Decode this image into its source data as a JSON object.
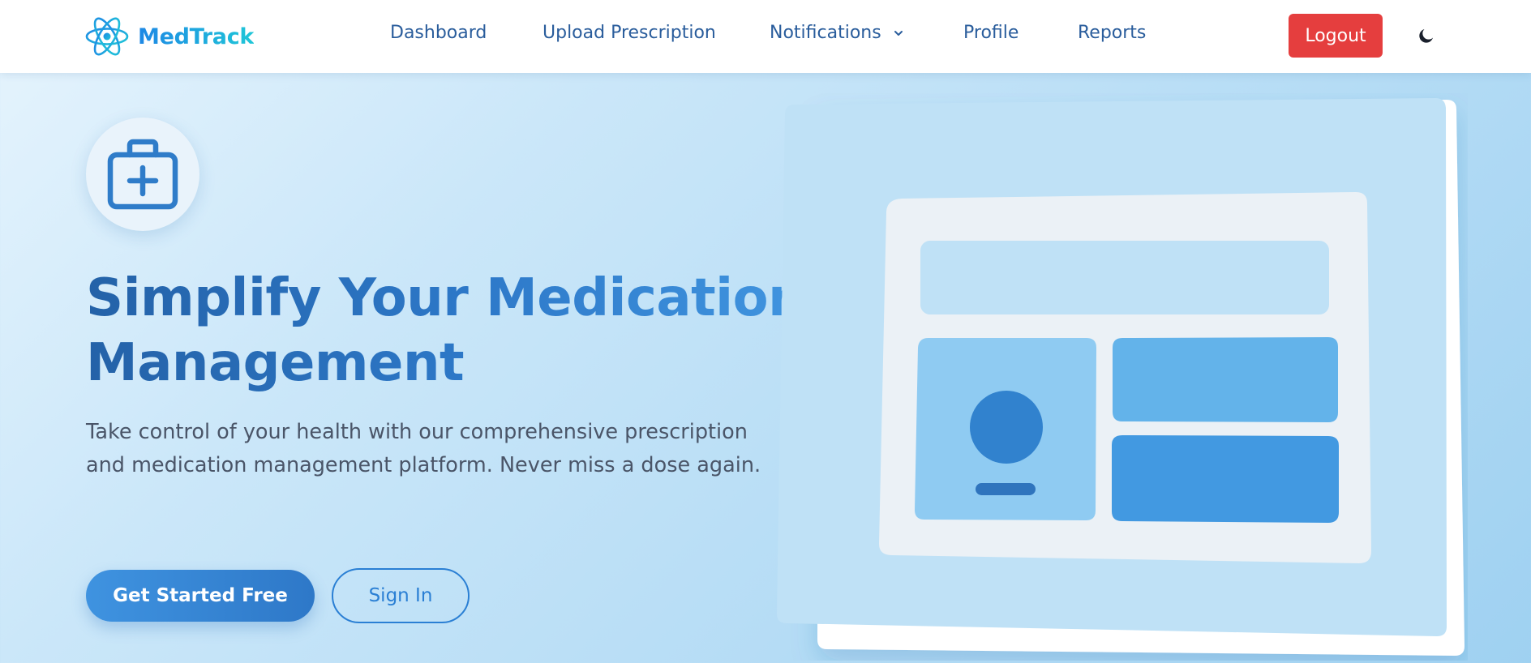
{
  "navbar": {
    "brand": {
      "name": "MedTrack",
      "icon": "atom-icon"
    },
    "links": [
      {
        "label": "Dashboard"
      },
      {
        "label": "Upload Prescription"
      },
      {
        "label": "Notifications",
        "icon": "chevron-down-icon"
      },
      {
        "label": "Profile"
      },
      {
        "label": "Reports"
      }
    ],
    "logout_label": "Logout",
    "theme_toggle_icon": "moon-icon"
  },
  "hero": {
    "icon": "medical-kit-icon",
    "title_line1": "Simplify Your Medication",
    "title_line2": "Management",
    "description": "Take control of your health with our comprehensive prescription and medication management platform. Never miss a dose again.",
    "primary_button": "Get Started Free",
    "secondary_button": "Sign In",
    "illustration": "dashboard-illustration"
  },
  "colors": {
    "accent": "#2b6cb8",
    "brand_gradient_start": "#1e88e5",
    "brand_gradient_end": "#1fc6d8",
    "logout": "#e53e3e",
    "link": "#2a5d9c"
  }
}
